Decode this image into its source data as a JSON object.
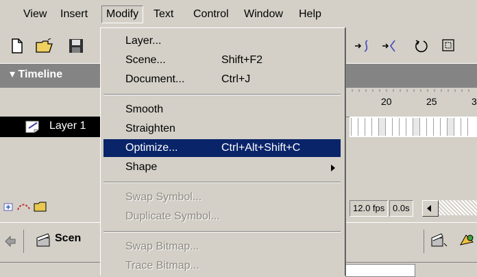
{
  "menubar": {
    "items": [
      {
        "label": "View"
      },
      {
        "label": "Insert"
      },
      {
        "label": "Modify"
      },
      {
        "label": "Text"
      },
      {
        "label": "Control"
      },
      {
        "label": "Window"
      },
      {
        "label": "Help"
      }
    ]
  },
  "toolbar": {
    "icons": [
      "new-file-icon",
      "open-folder-icon",
      "save-disk-icon",
      "smooth-icon",
      "straighten-icon",
      "rotate-icon",
      "scale-icon"
    ]
  },
  "timeline": {
    "title": "Timeline",
    "ruler_labels": [
      "20",
      "25",
      "3"
    ],
    "layer_name": "Layer 1"
  },
  "status": {
    "fps": "12.0 fps",
    "time": "0.0s"
  },
  "scenebar": {
    "scene_label": "Scen"
  },
  "modify_menu": {
    "items": [
      {
        "label": "Layer...",
        "shortcut": ""
      },
      {
        "label": "Scene...",
        "shortcut": "Shift+F2"
      },
      {
        "label": "Document...",
        "shortcut": "Ctrl+J"
      },
      {
        "label": "Smooth",
        "shortcut": ""
      },
      {
        "label": "Straighten",
        "shortcut": ""
      },
      {
        "label": "Optimize...",
        "shortcut": "Ctrl+Alt+Shift+C"
      },
      {
        "label": "Shape",
        "shortcut": ""
      },
      {
        "label": "Swap Symbol...",
        "shortcut": ""
      },
      {
        "label": "Duplicate Symbol...",
        "shortcut": ""
      },
      {
        "label": "Swap Bitmap...",
        "shortcut": ""
      },
      {
        "label": "Trace Bitmap...",
        "shortcut": ""
      }
    ]
  },
  "colors": {
    "highlight": "#0a246a",
    "chrome": "#d4d0c8",
    "timeline_header": "#848484"
  }
}
